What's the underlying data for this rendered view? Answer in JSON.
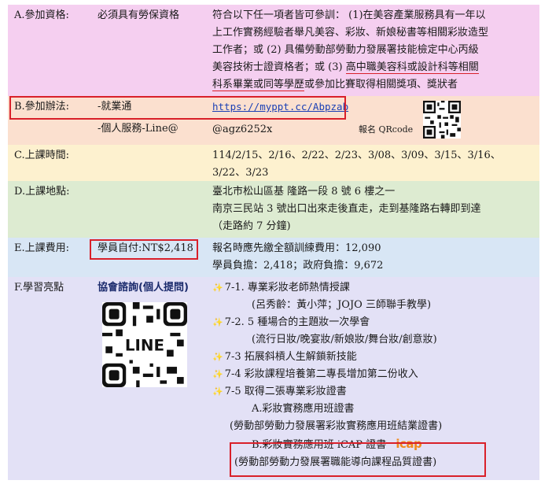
{
  "a": {
    "label": "A.參加資格:",
    "mid": "必須具有勞保資格",
    "lines": [
      "符合以下任一項者皆可參訓： (1)在美容產業服務具有一年以",
      "上工作實務經驗者舉凡美容、彩妝、新娘秘書等相關彩妝造型",
      "工作者；或 (2) 具備勞動部勞動力發展署技能檢定中心丙級",
      "美容技術士證資格者；或 (3) "
    ],
    "line4_underlined": "高中職美容科或設計科等相關",
    "line5_underlined": "科系畢業或同等學歷",
    "line5_rest": "或參加比賽取得相關獎項、獎狀者"
  },
  "b": {
    "label": "B.參加辦法:",
    "mid1": "-就業通",
    "link": "https://myppt.cc/Abpzab",
    "mid2": "-個人服務-Line@",
    "line_id": "@agz6252x",
    "qr_caption": "報名 QRcode"
  },
  "c": {
    "label": "C.上課時間:",
    "lines": [
      "114/2/15、2/16、2/22、2/23、3/08、3/09、3/15、3/16、",
      "3/22、3/23"
    ]
  },
  "d": {
    "label": "D.上課地點:",
    "lines": [
      "臺北市松山區基 隆路一段 8 號 6 樓之一",
      "南京三民站  3  號出口出來走後直走，走到基隆路右轉即到達",
      "（走路約 7 分鐘)"
    ]
  },
  "e": {
    "label": "E.上課費用:",
    "mid": "學員自付:NT$2,418",
    "lines": [
      "報名時應先繳全額訓練費用：12,090",
      "學員負擔：2,418；政府負擔：9,672"
    ]
  },
  "f": {
    "label": "F.學習亮點",
    "consult": "協會諮詢(個人提問)",
    "line_logo": "LINE",
    "items": [
      {
        "text": "7-1. 專業彩妝老師熱情授課",
        "star": true
      },
      {
        "text": "(呂秀齡：黃小萍；JOJO 三師聯手教學)",
        "star": false
      },
      {
        "text": "7-2. 5 種場合的主題妝一次學會",
        "star": true
      },
      {
        "text": "(流行日妝/晚宴妝/新娘妝/舞台妝/創意妝)",
        "star": false
      },
      {
        "text": "7-3 拓展斜槓人生解鎖新技能",
        "star": true
      },
      {
        "text": "7-4 彩妝課程培養第二專長增加第二份收入",
        "star": true
      },
      {
        "text": "7-5 取得二張專業彩妝證書",
        "star": true
      },
      {
        "text": "A.彩妝實務應用班證書",
        "star": false
      },
      {
        "text": "(勞動部勞動力發展署彩妝實務應用班結業證書)",
        "star": false
      }
    ],
    "cert_b": "B.彩妝實務應用班 iCAP 證書",
    "cert_b_sub": "(勞動部勞動力發展署職能導向課程品質證書)",
    "icap_logo": "icap"
  },
  "colors": {
    "row_a": "#f5cff0",
    "row_b": "#fbe0cf",
    "row_c": "#fdf1cf",
    "row_d": "#ddebd1",
    "row_e": "#d8e6f5",
    "row_f": "#e3e1f6",
    "accent_red": "#d9202a",
    "icap_orange": "#f08a1d"
  }
}
